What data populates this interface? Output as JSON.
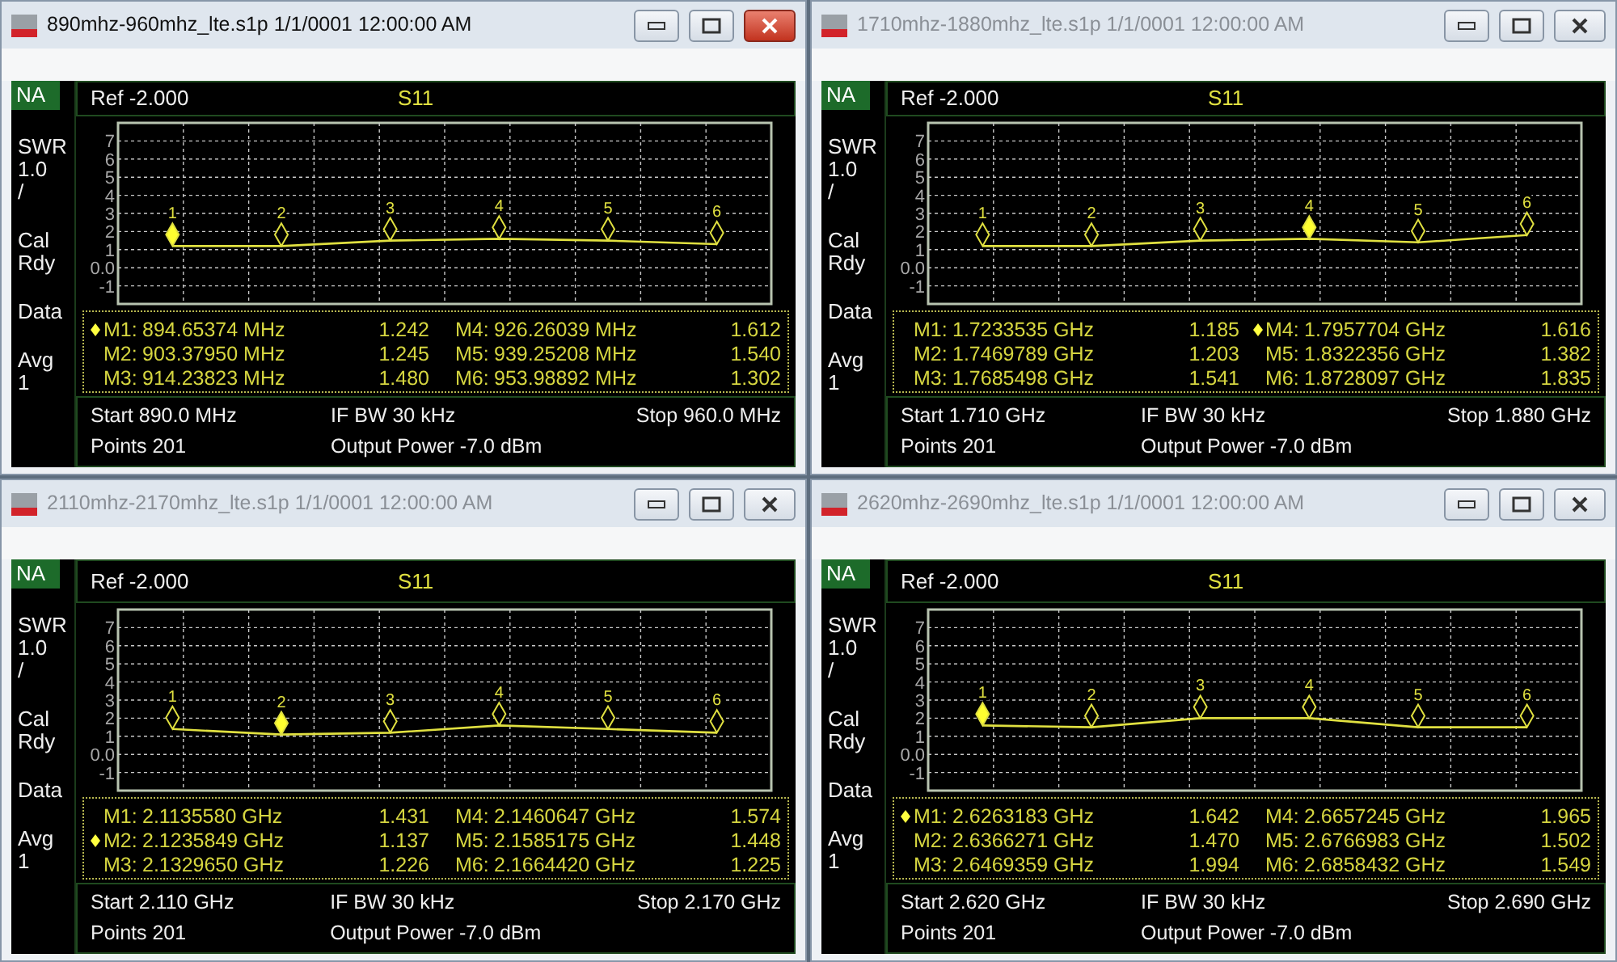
{
  "windows": [
    {
      "title": "890mhz-960mhz_lte.s1p 1/1/0001 12:00:00 AM",
      "active": true,
      "mode": "NA",
      "side_groups": [
        [
          "SWR",
          "1.0",
          "/"
        ],
        [
          "Cal",
          "Rdy"
        ],
        [
          "Data"
        ],
        [
          "Avg",
          "1"
        ]
      ],
      "ref": "Ref -2.000",
      "chart_data": {
        "type": "line",
        "categories": [
          null,
          null,
          null,
          null,
          null,
          null
        ],
        "yticks": [
          {
            "value": 7,
            "label": "7"
          },
          {
            "value": 6,
            "label": "6"
          },
          {
            "value": 5,
            "label": "5"
          },
          {
            "value": 4,
            "label": "4"
          },
          {
            "value": 3,
            "label": "3"
          },
          {
            "value": 2,
            "label": "2"
          },
          {
            "value": 1,
            "label": "1"
          },
          {
            "value": 0,
            "label": "0.0"
          },
          {
            "value": -1,
            "label": "-1"
          }
        ],
        "ylim": [
          -2,
          8
        ],
        "grid": true,
        "series": [
          {
            "name": "S11",
            "color": "#e0e040",
            "values": [
              1.2,
              1.2,
              1.5,
              1.6,
              1.5,
              1.3
            ]
          }
        ]
      },
      "markers": [
        {
          "tag": "1",
          "label": "M1:",
          "frequency": "894.65374 MHz",
          "reading": "1.242",
          "selected": true
        },
        {
          "tag": "2",
          "label": "M2:",
          "frequency": "903.37950 MHz",
          "reading": "1.245",
          "selected": false
        },
        {
          "tag": "3",
          "label": "M3:",
          "frequency": "914.23823 MHz",
          "reading": "1.480",
          "selected": false
        },
        {
          "tag": "4",
          "label": "M4:",
          "frequency": "926.26039 MHz",
          "reading": "1.612",
          "selected": false
        },
        {
          "tag": "5",
          "label": "M5:",
          "frequency": "939.25208 MHz",
          "reading": "1.540",
          "selected": false
        },
        {
          "tag": "6",
          "label": "M6:",
          "frequency": "953.98892 MHz",
          "reading": "1.302",
          "selected": false
        }
      ],
      "footer": {
        "start": "Start 890.0 MHz",
        "ifbw": "IF BW 30 kHz",
        "stop": "Stop 960.0 MHz",
        "points": "Points 201",
        "power": "Output Power -7.0 dBm"
      }
    },
    {
      "title": "1710mhz-1880mhz_lte.s1p 1/1/0001 12:00:00 AM",
      "active": false,
      "mode": "NA",
      "side_groups": [
        [
          "SWR",
          "1.0",
          "/"
        ],
        [
          "Cal",
          "Rdy"
        ],
        [
          "Data"
        ],
        [
          "Avg",
          "1"
        ]
      ],
      "ref": "Ref -2.000",
      "chart_data": {
        "type": "line",
        "categories": [
          null,
          null,
          null,
          null,
          null,
          null
        ],
        "yticks": [
          {
            "value": 7,
            "label": "7"
          },
          {
            "value": 6,
            "label": "6"
          },
          {
            "value": 5,
            "label": "5"
          },
          {
            "value": 4,
            "label": "4"
          },
          {
            "value": 3,
            "label": "3"
          },
          {
            "value": 2,
            "label": "2"
          },
          {
            "value": 1,
            "label": "1"
          },
          {
            "value": 0,
            "label": "0.0"
          },
          {
            "value": -1,
            "label": "-1"
          }
        ],
        "ylim": [
          -2,
          8
        ],
        "grid": true,
        "series": [
          {
            "name": "S11",
            "color": "#e0e040",
            "values": [
              1.2,
              1.2,
              1.5,
              1.6,
              1.4,
              1.8
            ]
          }
        ]
      },
      "markers": [
        {
          "tag": "1",
          "label": "M1:",
          "frequency": "1.7233535 GHz",
          "reading": "1.185",
          "selected": false
        },
        {
          "tag": "2",
          "label": "M2:",
          "frequency": "1.7469789 GHz",
          "reading": "1.203",
          "selected": false
        },
        {
          "tag": "3",
          "label": "M3:",
          "frequency": "1.7685498 GHz",
          "reading": "1.541",
          "selected": false
        },
        {
          "tag": "4",
          "label": "M4:",
          "frequency": "1.7957704 GHz",
          "reading": "1.616",
          "selected": true
        },
        {
          "tag": "5",
          "label": "M5:",
          "frequency": "1.8322356 GHz",
          "reading": "1.382",
          "selected": false
        },
        {
          "tag": "6",
          "label": "M6:",
          "frequency": "1.8728097 GHz",
          "reading": "1.835",
          "selected": false
        }
      ],
      "footer": {
        "start": "Start 1.710 GHz",
        "ifbw": "IF BW 30 kHz",
        "stop": "Stop 1.880 GHz",
        "points": "Points 201",
        "power": "Output Power -7.0 dBm"
      }
    },
    {
      "title": "2110mhz-2170mhz_lte.s1p 1/1/0001 12:00:00 AM",
      "active": false,
      "mode": "NA",
      "side_groups": [
        [
          "SWR",
          "1.0",
          "/"
        ],
        [
          "Cal",
          "Rdy"
        ],
        [
          "Data"
        ],
        [
          "Avg",
          "1"
        ]
      ],
      "ref": "Ref -2.000",
      "chart_data": {
        "type": "line",
        "categories": [
          null,
          null,
          null,
          null,
          null,
          null
        ],
        "yticks": [
          {
            "value": 7,
            "label": "7"
          },
          {
            "value": 6,
            "label": "6"
          },
          {
            "value": 5,
            "label": "5"
          },
          {
            "value": 4,
            "label": "4"
          },
          {
            "value": 3,
            "label": "3"
          },
          {
            "value": 2,
            "label": "2"
          },
          {
            "value": 1,
            "label": "1"
          },
          {
            "value": 0,
            "label": "0.0"
          },
          {
            "value": -1,
            "label": "-1"
          }
        ],
        "ylim": [
          -2,
          8
        ],
        "grid": true,
        "series": [
          {
            "name": "S11",
            "color": "#e0e040",
            "values": [
              1.4,
              1.1,
              1.2,
              1.6,
              1.4,
              1.2
            ]
          }
        ]
      },
      "markers": [
        {
          "tag": "1",
          "label": "M1:",
          "frequency": "2.1135580 GHz",
          "reading": "1.431",
          "selected": false
        },
        {
          "tag": "2",
          "label": "M2:",
          "frequency": "2.1235849 GHz",
          "reading": "1.137",
          "selected": true
        },
        {
          "tag": "3",
          "label": "M3:",
          "frequency": "2.1329650 GHz",
          "reading": "1.226",
          "selected": false
        },
        {
          "tag": "4",
          "label": "M4:",
          "frequency": "2.1460647 GHz",
          "reading": "1.574",
          "selected": false
        },
        {
          "tag": "5",
          "label": "M5:",
          "frequency": "2.1585175 GHz",
          "reading": "1.448",
          "selected": false
        },
        {
          "tag": "6",
          "label": "M6:",
          "frequency": "2.1664420 GHz",
          "reading": "1.225",
          "selected": false
        }
      ],
      "footer": {
        "start": "Start 2.110 GHz",
        "ifbw": "IF BW 30 kHz",
        "stop": "Stop 2.170 GHz",
        "points": "Points 201",
        "power": "Output Power -7.0 dBm"
      }
    },
    {
      "title": "2620mhz-2690mhz_lte.s1p 1/1/0001 12:00:00 AM",
      "active": false,
      "mode": "NA",
      "side_groups": [
        [
          "SWR",
          "1.0",
          "/"
        ],
        [
          "Cal",
          "Rdy"
        ],
        [
          "Data"
        ],
        [
          "Avg",
          "1"
        ]
      ],
      "ref": "Ref -2.000",
      "chart_data": {
        "type": "line",
        "categories": [
          null,
          null,
          null,
          null,
          null,
          null
        ],
        "yticks": [
          {
            "value": 7,
            "label": "7"
          },
          {
            "value": 6,
            "label": "6"
          },
          {
            "value": 5,
            "label": "5"
          },
          {
            "value": 4,
            "label": "4"
          },
          {
            "value": 3,
            "label": "3"
          },
          {
            "value": 2,
            "label": "2"
          },
          {
            "value": 1,
            "label": "1"
          },
          {
            "value": 0,
            "label": "0.0"
          },
          {
            "value": -1,
            "label": "-1"
          }
        ],
        "ylim": [
          -2,
          8
        ],
        "grid": true,
        "series": [
          {
            "name": "S11",
            "color": "#e0e040",
            "values": [
              1.6,
              1.5,
              2.0,
              2.0,
              1.5,
              1.5
            ]
          }
        ]
      },
      "markers": [
        {
          "tag": "1",
          "label": "M1:",
          "frequency": "2.6263183 GHz",
          "reading": "1.642",
          "selected": true
        },
        {
          "tag": "2",
          "label": "M2:",
          "frequency": "2.6366271 GHz",
          "reading": "1.470",
          "selected": false
        },
        {
          "tag": "3",
          "label": "M3:",
          "frequency": "2.6469359 GHz",
          "reading": "1.994",
          "selected": false
        },
        {
          "tag": "4",
          "label": "M4:",
          "frequency": "2.6657245 GHz",
          "reading": "1.965",
          "selected": false
        },
        {
          "tag": "5",
          "label": "M5:",
          "frequency": "2.6766983 GHz",
          "reading": "1.502",
          "selected": false
        },
        {
          "tag": "6",
          "label": "M6:",
          "frequency": "2.6858432 GHz",
          "reading": "1.549",
          "selected": false
        }
      ],
      "footer": {
        "start": "Start 2.620 GHz",
        "ifbw": "IF BW 30 kHz",
        "stop": "Stop 2.690 GHz",
        "points": "Points 201",
        "power": "Output Power -7.0 dBm"
      }
    }
  ]
}
